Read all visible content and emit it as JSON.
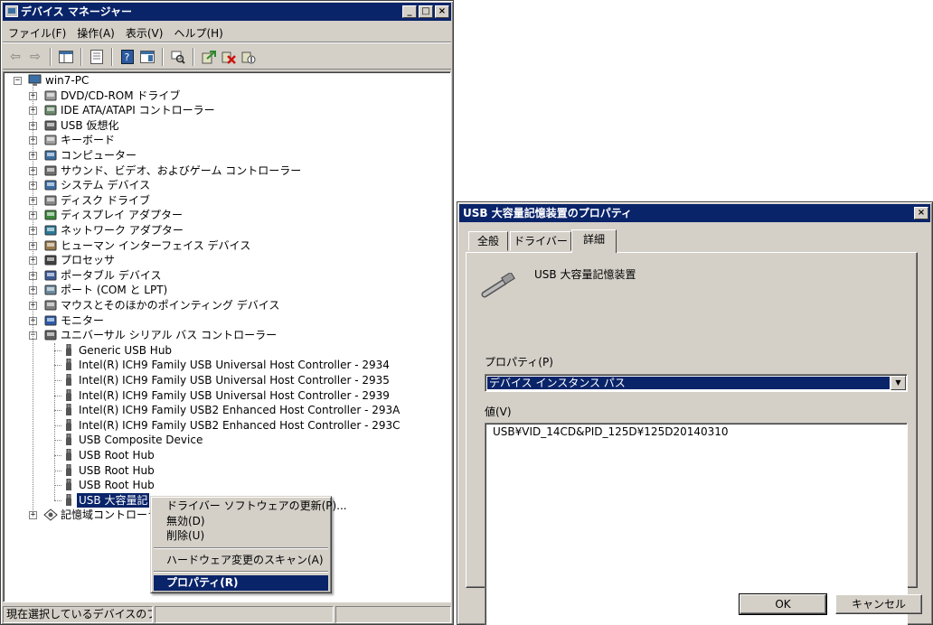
{
  "device_manager": {
    "title": "デバイス マネージャー",
    "window_buttons": {
      "minimize": "_",
      "maximize": "□",
      "close": "×"
    },
    "menu": [
      "ファイル(F)",
      "操作(A)",
      "表示(V)",
      "ヘルプ(H)"
    ],
    "tree": {
      "root": "win7-PC",
      "categories": [
        {
          "label": "DVD/CD-ROM ドライブ",
          "icon": "dvd-drive-icon"
        },
        {
          "label": "IDE ATA/ATAPI コントローラー",
          "icon": "ide-controller-icon"
        },
        {
          "label": "USB 仮想化",
          "icon": "usb-icon"
        },
        {
          "label": "キーボード",
          "icon": "keyboard-icon"
        },
        {
          "label": "コンピューター",
          "icon": "computer-icon"
        },
        {
          "label": "サウンド、ビデオ、およびゲーム コントローラー",
          "icon": "sound-icon"
        },
        {
          "label": "システム デバイス",
          "icon": "system-device-icon"
        },
        {
          "label": "ディスク ドライブ",
          "icon": "disk-drive-icon"
        },
        {
          "label": "ディスプレイ アダプター",
          "icon": "display-adapter-icon"
        },
        {
          "label": "ネットワーク アダプター",
          "icon": "network-adapter-icon"
        },
        {
          "label": "ヒューマン インターフェイス デバイス",
          "icon": "hid-icon"
        },
        {
          "label": "プロセッサ",
          "icon": "processor-icon"
        },
        {
          "label": "ポータブル デバイス",
          "icon": "portable-device-icon"
        },
        {
          "label": "ポート (COM と LPT)",
          "icon": "port-icon"
        },
        {
          "label": "マウスとそのほかのポインティング デバイス",
          "icon": "mouse-icon"
        },
        {
          "label": "モニター",
          "icon": "monitor-icon"
        },
        {
          "label": "ユニバーサル シリアル バス コントローラー",
          "icon": "usb-controller-icon"
        }
      ],
      "usb_children": [
        "Generic USB Hub",
        "Intel(R) ICH9 Family USB Universal Host Controller - 2934",
        "Intel(R) ICH9 Family USB Universal Host Controller - 2935",
        "Intel(R) ICH9 Family USB Universal Host Controller - 2939",
        "Intel(R) ICH9 Family USB2 Enhanced Host Controller - 293A",
        "Intel(R) ICH9 Family USB2 Enhanced Host Controller - 293C",
        "USB Composite Device",
        "USB Root Hub",
        "USB Root Hub",
        "USB Root Hub",
        "USB 大容量記"
      ],
      "last_category": "記憶域コントローラ"
    },
    "context_menu": {
      "update": "ドライバー ソフトウェアの更新(P)...",
      "disable": "無効(D)",
      "uninstall": "削除(U)",
      "scan": "ハードウェア変更のスキャン(A)",
      "properties": "プロパティ(R)"
    },
    "status": "現在選択しているデバイスのプロ"
  },
  "properties_dialog": {
    "title": "USB 大容量記憶装置のプロパティ",
    "close": "×",
    "tabs": [
      "全般",
      "ドライバー",
      "詳細"
    ],
    "active_tab": "詳細",
    "device_name": "USB 大容量記憶装置",
    "property_label": "プロパティ(P)",
    "property_value": "デバイス インスタンス パス",
    "value_label": "値(V)",
    "value": "USB¥VID_14CD&PID_125D¥125D20140310",
    "ok": "OK",
    "cancel": "キャンセル"
  }
}
